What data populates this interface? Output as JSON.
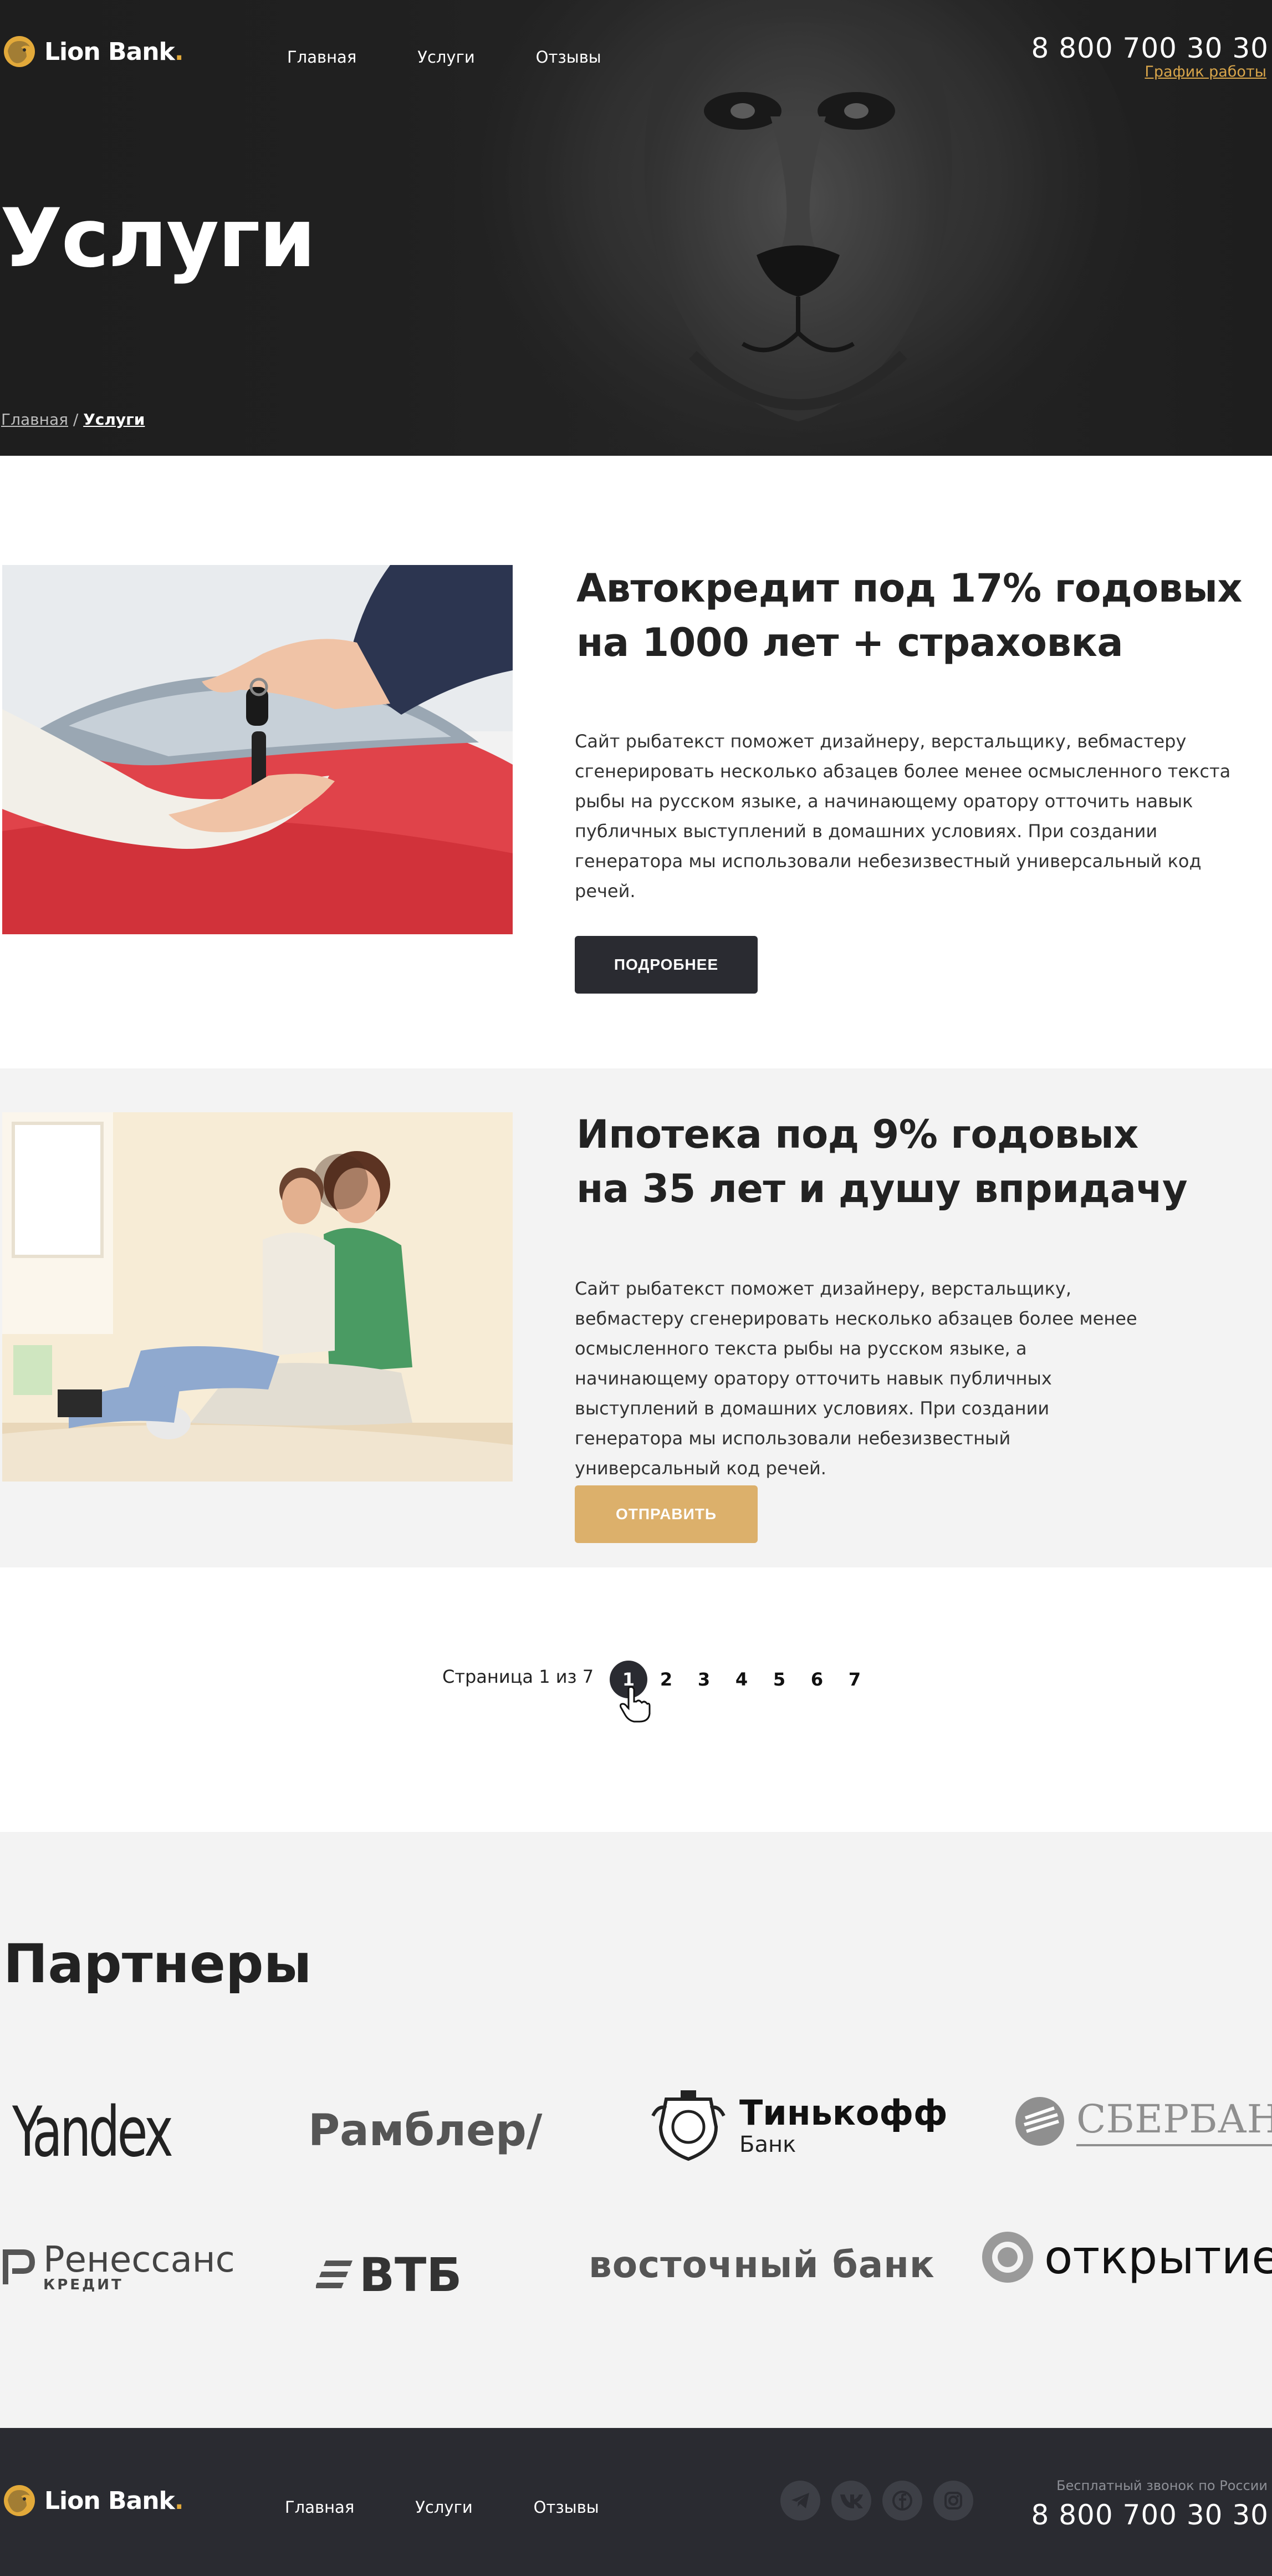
{
  "header": {
    "logo_text": "Lion Bank",
    "logo_dot": ".",
    "nav": [
      "Главная",
      "Услуги",
      "Отзывы"
    ],
    "phone": "8 800 700 30 30",
    "schedule_link": "График работы"
  },
  "hero": {
    "title": "Услуги",
    "breadcrumb_home": "Главная",
    "breadcrumb_sep": " / ",
    "breadcrumb_current": "Услуги"
  },
  "services": [
    {
      "title_line1": "Автокредит под 17% годовых",
      "title_line2": "на 1000 лет + страховка",
      "text": "Сайт рыбатекст поможет дизайнеру, верстальщику, вебмастеру сгенерировать несколько абзацев более менее осмысленного текста рыбы на русском языке, а начинающему оратору отточить навык публичных выступлений в домашних условиях. При создании генератора мы использовали небезизвестный универсальный код речей.",
      "button": "ПОДРОБНЕЕ"
    },
    {
      "title_line1": "Ипотека под 9% годовых",
      "title_line2": "на 35 лет и душу впридачу",
      "text": "Сайт рыбатекст поможет дизайнеру, верстальщику, вебмастеру сгенерировать несколько абзацев более менее осмысленного текста рыбы на русском языке, а начинающему оратору отточить навык публичных выступлений в домашних условиях. При создании генератора мы использовали небезизвестный универсальный код речей.",
      "button": "ОТПРАВИТЬ"
    }
  ],
  "pagination": {
    "info": "Страница 1 из 7",
    "pages": [
      "1",
      "2",
      "3",
      "4",
      "5",
      "6",
      "7"
    ],
    "active": "1"
  },
  "partners": {
    "title": "Партнеры",
    "logos": {
      "yandex": "Yandex",
      "rambler": "Рамблер/",
      "tinkoff_1": "Тинькофф",
      "tinkoff_2": "Банк",
      "sber": "СБЕРБАНК",
      "renaissance_1": "Ренессанс",
      "renaissance_2": "КРЕДИТ",
      "vtb": "ВТБ",
      "vostochny": "восточный банк",
      "otkritie": "открытие"
    }
  },
  "footer": {
    "logo_text": "Lion Bank",
    "logo_dot": ".",
    "nav": [
      "Главная",
      "Услуги",
      "Отзывы"
    ],
    "free_call": "Бесплатный звонок по России",
    "phone": "8 800 700 30 30"
  },
  "colors": {
    "accent_gold": "#dcb06b",
    "dark": "#2a2b31",
    "light_bg": "#f3f3f3"
  }
}
